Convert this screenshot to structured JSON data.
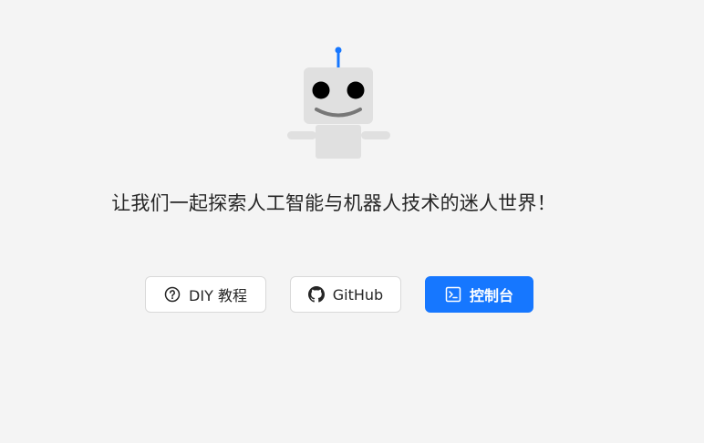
{
  "tagline": "让我们一起探索人工智能与机器人技术的迷人世界！",
  "colors": {
    "background": "#f4f4f4",
    "primary": "#1677ff",
    "robot_body": "#e0e0e0",
    "robot_antenna": "#1677ff"
  },
  "actions": [
    {
      "label": "DIY 教程",
      "icon": "question-circle-icon",
      "style": "default"
    },
    {
      "label": "GitHub",
      "icon": "github-icon",
      "style": "default"
    },
    {
      "label": "控制台",
      "icon": "terminal-icon",
      "style": "primary"
    }
  ]
}
